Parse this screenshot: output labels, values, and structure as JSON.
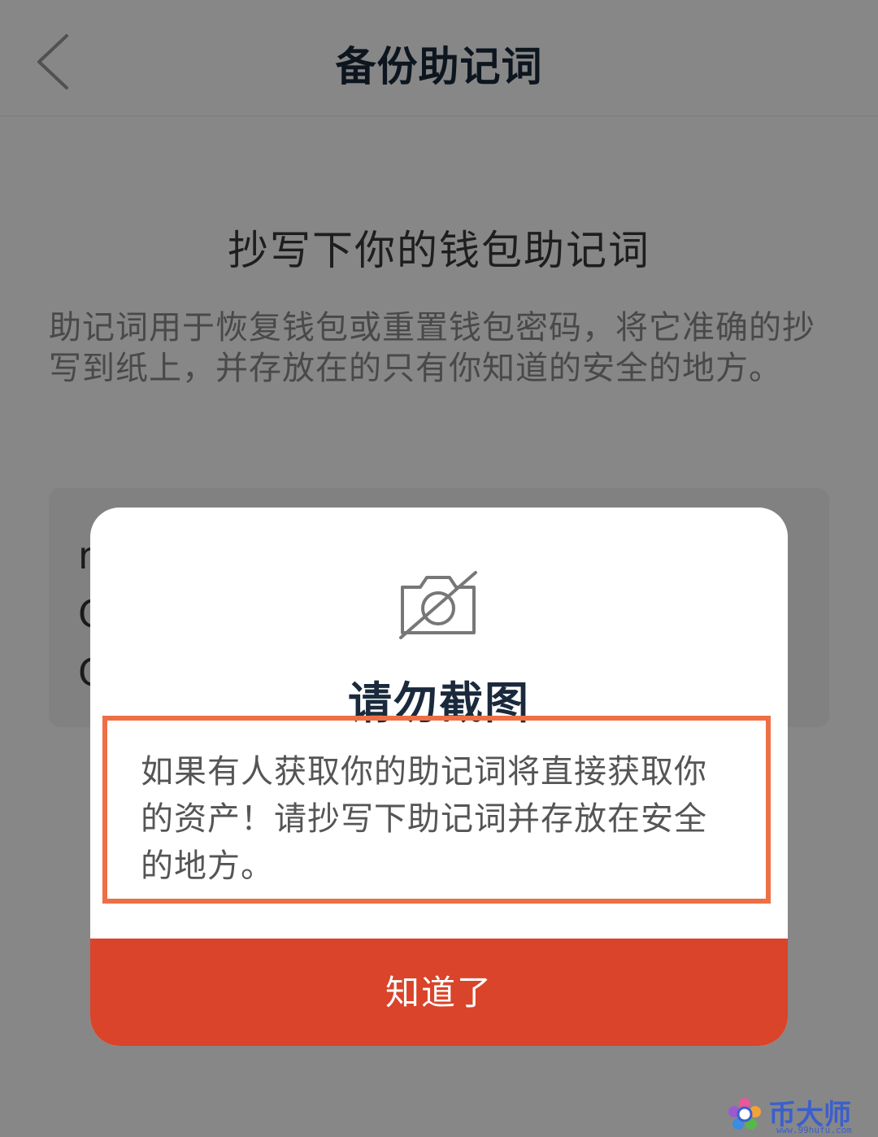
{
  "header": {
    "title": "备份助记词"
  },
  "content": {
    "headline": "抄写下你的钱包助记词",
    "description": "助记词用于恢复钱包或重置钱包密码，将它准确的抄写到纸上，并存放在的只有你知道的安全的地方。",
    "mnemonic_visible_fragments": [
      "r",
      "C",
      "C"
    ]
  },
  "modal": {
    "icon": "no-camera-icon",
    "title": "请勿截图",
    "message": "如果有人获取你的助记词将直接获取你的资产！请抄写下助记词并存放在安全的地方。",
    "button_label": "知道了"
  },
  "watermark": {
    "text": "币大师",
    "url": "www.99hufu.com"
  },
  "colors": {
    "accent": "#d9442a",
    "highlight_border": "#ee6f45",
    "title": "#1a2a3c"
  }
}
